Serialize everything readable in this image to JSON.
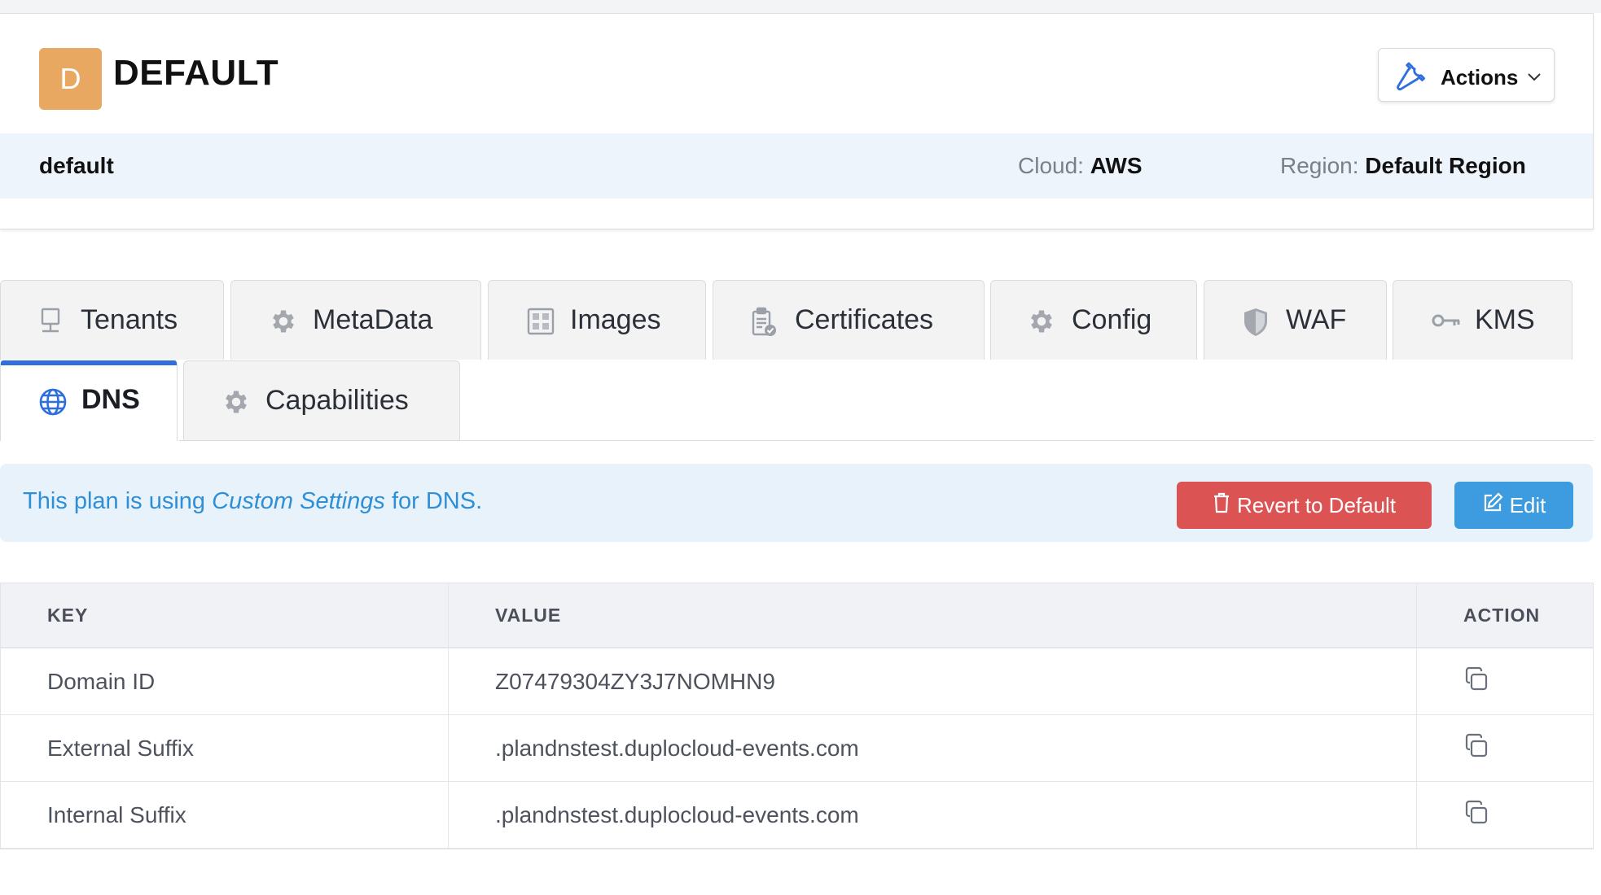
{
  "header": {
    "avatar_letter": "D",
    "title": "DEFAULT",
    "actions_label": "Actions",
    "plan_name": "default",
    "cloud_label": "Cloud:",
    "cloud_value": "AWS",
    "region_label": "Region:",
    "region_value": "Default Region"
  },
  "tabs": [
    {
      "label": "Tenants",
      "icon": "monitor-icon"
    },
    {
      "label": "MetaData",
      "icon": "gear-icon"
    },
    {
      "label": "Images",
      "icon": "grid-icon"
    },
    {
      "label": "Certificates",
      "icon": "certificate-icon"
    },
    {
      "label": "Config",
      "icon": "gear-icon"
    },
    {
      "label": "WAF",
      "icon": "shield-icon"
    },
    {
      "label": "KMS",
      "icon": "key-icon"
    },
    {
      "label": "DNS",
      "icon": "globe-icon",
      "active": true
    },
    {
      "label": "Capabilities",
      "icon": "gear-icon"
    }
  ],
  "banner": {
    "prefix": "This plan is using ",
    "emphasis": "Custom Settings",
    "suffix": " for DNS.",
    "revert_label": "Revert to Default",
    "edit_label": "Edit"
  },
  "table": {
    "columns": [
      "KEY",
      "VALUE",
      "ACTION"
    ],
    "rows": [
      {
        "key": "Domain ID",
        "value": "Z07479304ZY3J7NOMHN9"
      },
      {
        "key": "External Suffix",
        "value": ".plandnstest.duplocloud-events.com"
      },
      {
        "key": "Internal Suffix",
        "value": ".plandnstest.duplocloud-events.com"
      }
    ]
  },
  "colors": {
    "avatar": "#e8a862",
    "active_tab_bar": "#2f6fdc",
    "revert_button": "#dc5353",
    "edit_button": "#3d9be0",
    "banner_text": "#2f8fd6"
  }
}
